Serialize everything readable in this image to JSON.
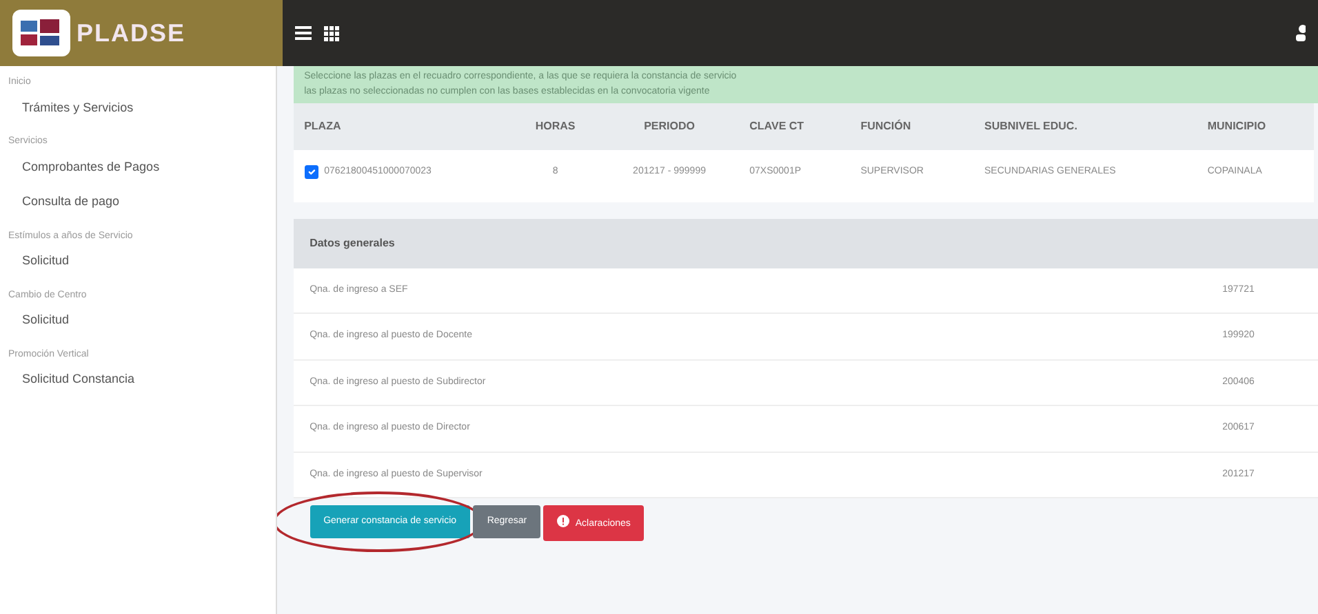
{
  "brand": "PLADSE",
  "sidebar": [
    {
      "heading": "Inicio",
      "items": [
        {
          "label": "Trámites y Servicios"
        }
      ]
    },
    {
      "heading": "Servicios",
      "items": [
        {
          "label": "Comprobantes de Pagos"
        },
        {
          "label": "Consulta de pago"
        }
      ]
    },
    {
      "heading": "Estímulos a años de Servicio",
      "items": [
        {
          "label": "Solicitud"
        }
      ]
    },
    {
      "heading": "Cambio de Centro",
      "items": [
        {
          "label": "Solicitud"
        }
      ]
    },
    {
      "heading": "Promoción Vertical",
      "items": [
        {
          "label": "Solicitud Constancia"
        }
      ]
    }
  ],
  "alert": {
    "lines": [
      "Seleccione las plazas en el recuadro correspondiente, a las que se requiera la constancia de servicio",
      "las plazas no seleccionadas no cumplen con las bases establecidas en la convocatoria vigente"
    ]
  },
  "table": {
    "columns": [
      "PLAZA",
      "HORAS",
      "PERIODO",
      "CLAVE CT",
      "FUNCIÓN",
      "SUBNIVEL EDUC.",
      "MUNICIPIO"
    ],
    "rows": [
      {
        "checked": true,
        "cells": [
          "07621800451000070023",
          "8",
          "201217 - 999999",
          "07XS0001P",
          "SUPERVISOR",
          "SECUNDARIAS GENERALES",
          "COPAINALA"
        ]
      }
    ]
  },
  "general": {
    "title": "Datos generales",
    "rows": [
      {
        "label": "Qna. de ingreso a SEF",
        "value": "197721"
      },
      {
        "label": "Qna. de ingreso al puesto de Docente",
        "value": "199920"
      },
      {
        "label": "Qna. de ingreso al puesto de Subdirector",
        "value": "200406"
      },
      {
        "label": "Qna. de ingreso al puesto de Director",
        "value": "200617"
      },
      {
        "label": "Qna. de ingreso al puesto de Supervisor",
        "value": "201217"
      }
    ]
  },
  "buttons": [
    {
      "label": "Generar constancia de servicio",
      "kind": "info",
      "highlighted": true
    },
    {
      "label": "Regresar",
      "kind": "secondary",
      "highlighted": false
    },
    {
      "label": "Aclaraciones",
      "kind": "danger",
      "highlighted": false
    }
  ]
}
